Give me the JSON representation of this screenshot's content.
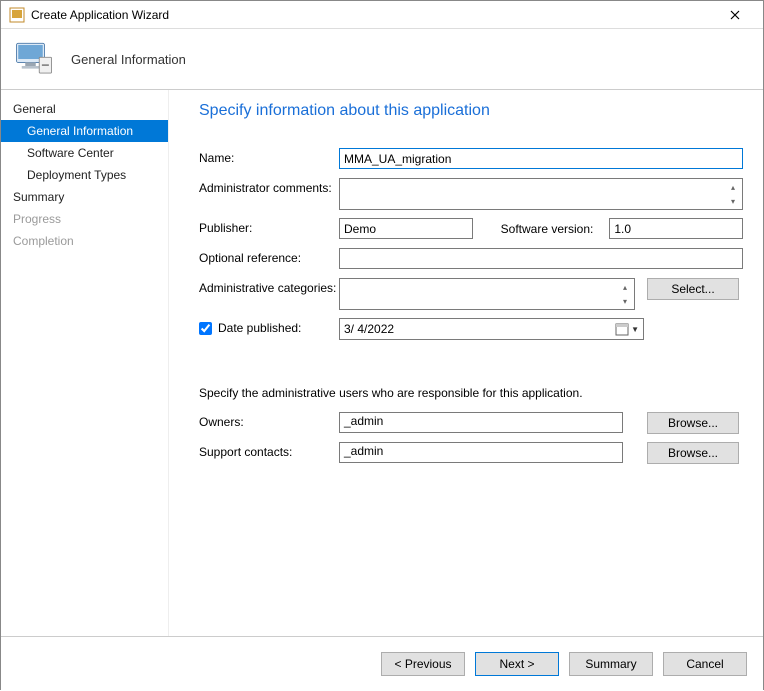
{
  "window": {
    "title": "Create Application Wizard"
  },
  "header": {
    "page_label": "General Information"
  },
  "sidebar": {
    "groups": {
      "general": "General",
      "summary": "Summary",
      "progress": "Progress",
      "completion": "Completion"
    },
    "general_children": {
      "general_information": "General Information",
      "software_center": "Software Center",
      "deployment_types": "Deployment Types"
    }
  },
  "main": {
    "heading": "Specify information about this application",
    "labels": {
      "name": "Name:",
      "admin_comments": "Administrator comments:",
      "publisher": "Publisher:",
      "software_version": "Software version:",
      "optional_reference": "Optional reference:",
      "admin_categories": "Administrative categories:",
      "date_published": "Date published:",
      "responsibility_note": "Specify the administrative users who are responsible for this application.",
      "owners": "Owners:",
      "support_contacts": "Support contacts:"
    },
    "values": {
      "name": "MMA_UA_migration",
      "admin_comments": "",
      "publisher": "Demo",
      "software_version": "1.0",
      "optional_reference": "",
      "admin_categories": "",
      "date_published_checked": true,
      "date_published": "3/  4/2022",
      "owners": "_admin",
      "support_contacts": "_admin"
    },
    "buttons": {
      "select": "Select...",
      "browse": "Browse..."
    }
  },
  "footer": {
    "previous": "< Previous",
    "next": "Next >",
    "summary": "Summary",
    "cancel": "Cancel"
  }
}
